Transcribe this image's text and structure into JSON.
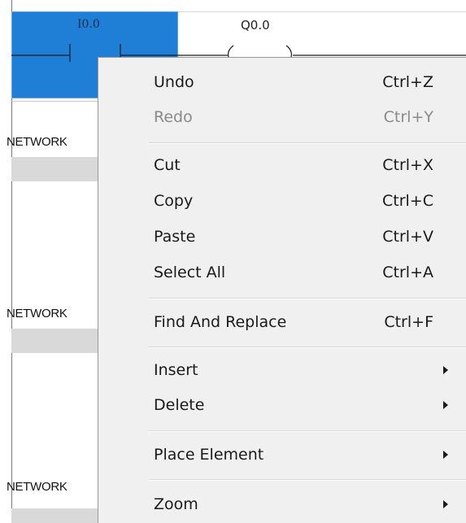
{
  "ladder": {
    "contact_label": "I0.0",
    "coil_label": "Q0.0",
    "networks": [
      "NETWORK",
      "NETWORK",
      "NETWORK"
    ]
  },
  "context_menu": {
    "items": [
      {
        "label": "Undo",
        "shortcut": "Ctrl+Z",
        "enabled": true
      },
      {
        "label": "Redo",
        "shortcut": "Ctrl+Y",
        "enabled": false
      },
      {
        "label": "Cut",
        "shortcut": "Ctrl+X",
        "enabled": true
      },
      {
        "label": "Copy",
        "shortcut": "Ctrl+C",
        "enabled": true
      },
      {
        "label": "Paste",
        "shortcut": "Ctrl+V",
        "enabled": true
      },
      {
        "label": "Select All",
        "shortcut": "Ctrl+A",
        "enabled": true
      },
      {
        "label": "Find And Replace",
        "shortcut": "Ctrl+F",
        "enabled": true
      },
      {
        "label": "Insert",
        "has_submenu": true
      },
      {
        "label": "Delete",
        "has_submenu": true
      },
      {
        "label": "Place Element",
        "has_submenu": true
      },
      {
        "label": "Zoom",
        "has_submenu": true
      }
    ]
  },
  "colors": {
    "selection": "#1f7fd6",
    "menu_background": "#f0f0f0",
    "disabled_text": "#8a8a8a",
    "network_band": "#d9d9d9"
  }
}
